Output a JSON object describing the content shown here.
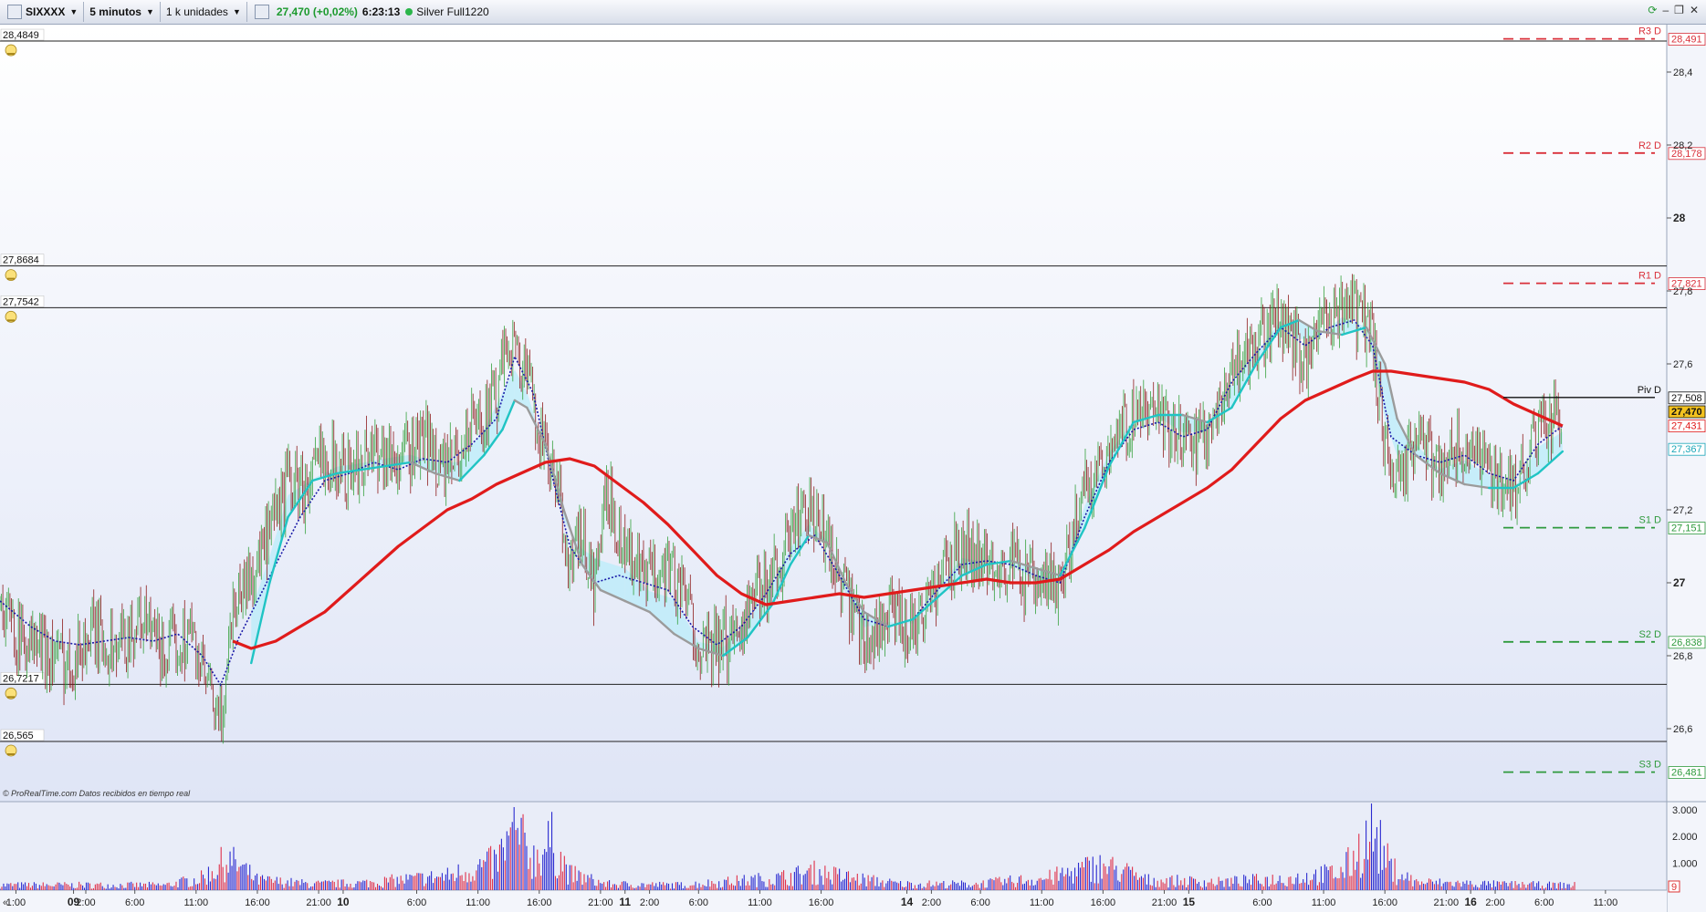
{
  "toolbar": {
    "symbol": "SIXXXX",
    "interval": "5 minutos",
    "units": "1 k unidades",
    "price": "27,470 (+0,02%)",
    "time": "6:23:13",
    "account": "Silver Full1220",
    "window_icons": [
      "refresh-icon",
      "minimize-icon",
      "restore-icon",
      "close-icon"
    ]
  },
  "copyright": "© ProRealTime.com  Datos recibidos en tiempo real",
  "colors": {
    "ma_long": "#e01b1b",
    "ma_short": "#20c4c4",
    "ma_short_falling": "#9b9b9b",
    "dotted": "#1a1aa8",
    "candles_up": "#2e9e35",
    "candles_down": "#8b1313",
    "cloud": "#b9ecfa",
    "resistance": "#d9303a",
    "support": "#2f9a3d",
    "pivot": "#111111",
    "price_tag": "#f3c21f"
  },
  "chart_data": {
    "type": "line",
    "ylim": [
      26.4,
      28.53
    ],
    "y_ticks": [
      "28,4",
      "28,2",
      "28",
      "27,8",
      "27,6",
      "27,2",
      "27",
      "26,8",
      "26,6"
    ],
    "x_ticks": [
      {
        "label": "1:00",
        "t": -2.2
      },
      {
        "label": "09",
        "t": 2.5,
        "bold": true
      },
      {
        "label": "2:00",
        "t": 3.5
      },
      {
        "label": "6:00",
        "t": 7.5
      },
      {
        "label": "11:00",
        "t": 12.5
      },
      {
        "label": "16:00",
        "t": 17.5
      },
      {
        "label": "21:00",
        "t": 22.5
      },
      {
        "label": "10",
        "t": 24.5,
        "bold": true
      },
      {
        "label": "6:00",
        "t": 30.5
      },
      {
        "label": "11:00",
        "t": 35.5
      },
      {
        "label": "16:00",
        "t": 40.5
      },
      {
        "label": "21:00",
        "t": 45.5
      },
      {
        "label": "11",
        "t": 47.5,
        "bold": true
      },
      {
        "label": "2:00",
        "t": 49.5
      },
      {
        "label": "6:00",
        "t": 53.5
      },
      {
        "label": "11:00",
        "t": 58.5
      },
      {
        "label": "16:00",
        "t": 63.5
      },
      {
        "label": "14",
        "t": 70.5,
        "bold": true
      },
      {
        "label": "2:00",
        "t": 72.5
      },
      {
        "label": "6:00",
        "t": 76.5
      },
      {
        "label": "11:00",
        "t": 81.5
      },
      {
        "label": "16:00",
        "t": 86.5
      },
      {
        "label": "21:00",
        "t": 91.5
      },
      {
        "label": "15",
        "t": 93.5,
        "bold": true
      },
      {
        "label": "6:00",
        "t": 99.5
      },
      {
        "label": "11:00",
        "t": 104.5
      },
      {
        "label": "16:00",
        "t": 109.5
      },
      {
        "label": "21:00",
        "t": 114.5
      },
      {
        "label": "16",
        "t": 116.5,
        "bold": true
      },
      {
        "label": "2:00",
        "t": 118.5
      },
      {
        "label": "6:00",
        "t": 122.5
      },
      {
        "label": "11:00",
        "t": 127.5
      }
    ],
    "x_range": [
      -3.5,
      132.5
    ],
    "price_series": [
      [
        -3.5,
        26.95
      ],
      [
        -2,
        26.85
      ],
      [
        0,
        26.82
      ],
      [
        2,
        26.78
      ],
      [
        4,
        26.86
      ],
      [
        6,
        26.82
      ],
      [
        8,
        26.9
      ],
      [
        10,
        26.8
      ],
      [
        12,
        26.87
      ],
      [
        13.5,
        26.7
      ],
      [
        14.5,
        26.6
      ],
      [
        15.5,
        26.95
      ],
      [
        17,
        27.02
      ],
      [
        18.5,
        27.12
      ],
      [
        20,
        27.28
      ],
      [
        21.5,
        27.25
      ],
      [
        23,
        27.36
      ],
      [
        25,
        27.3
      ],
      [
        27,
        27.38
      ],
      [
        29,
        27.33
      ],
      [
        31,
        27.4
      ],
      [
        33,
        27.3
      ],
      [
        35,
        27.43
      ],
      [
        37,
        27.5
      ],
      [
        38,
        27.68
      ],
      [
        39,
        27.6
      ],
      [
        40,
        27.5
      ],
      [
        41,
        27.35
      ],
      [
        42,
        27.25
      ],
      [
        43,
        27.05
      ],
      [
        44,
        27.12
      ],
      [
        45,
        26.98
      ],
      [
        46,
        27.25
      ],
      [
        47.5,
        27.1
      ],
      [
        49,
        27.0
      ],
      [
        51,
        27.06
      ],
      [
        53,
        26.9
      ],
      [
        54,
        26.8
      ],
      [
        56,
        26.85
      ],
      [
        58,
        26.95
      ],
      [
        60,
        27.05
      ],
      [
        62,
        27.2
      ],
      [
        64,
        27.12
      ],
      [
        65.5,
        26.95
      ],
      [
        67,
        26.85
      ],
      [
        69,
        26.9
      ],
      [
        71,
        26.88
      ],
      [
        73,
        27.0
      ],
      [
        75,
        27.1
      ],
      [
        77,
        27.06
      ],
      [
        79,
        27.05
      ],
      [
        81,
        26.98
      ],
      [
        83,
        27.0
      ],
      [
        85,
        27.25
      ],
      [
        87,
        27.38
      ],
      [
        89,
        27.45
      ],
      [
        91,
        27.45
      ],
      [
        93,
        27.38
      ],
      [
        95,
        27.4
      ],
      [
        97,
        27.58
      ],
      [
        99,
        27.65
      ],
      [
        101,
        27.73
      ],
      [
        103,
        27.6
      ],
      [
        105,
        27.72
      ],
      [
        106.5,
        27.78
      ],
      [
        107.5,
        27.72
      ],
      [
        108.5,
        27.68
      ],
      [
        109.5,
        27.35
      ],
      [
        110.5,
        27.28
      ],
      [
        112,
        27.4
      ],
      [
        114,
        27.32
      ],
      [
        116,
        27.38
      ],
      [
        118,
        27.32
      ],
      [
        120,
        27.25
      ],
      [
        122,
        27.42
      ],
      [
        124,
        27.45
      ]
    ],
    "ma_short_series": [
      [
        17,
        26.78
      ],
      [
        18.5,
        27.0
      ],
      [
        20,
        27.18
      ],
      [
        22,
        27.28
      ],
      [
        24,
        27.3
      ],
      [
        26,
        27.31
      ],
      [
        28,
        27.32
      ],
      [
        30,
        27.33
      ],
      [
        32,
        27.3
      ],
      [
        34,
        27.28
      ],
      [
        36,
        27.35
      ],
      [
        37.5,
        27.42
      ],
      [
        38.5,
        27.5
      ],
      [
        39.5,
        27.48
      ],
      [
        41,
        27.38
      ],
      [
        42.5,
        27.2
      ],
      [
        44,
        27.05
      ],
      [
        45.5,
        26.98
      ],
      [
        47.5,
        26.95
      ],
      [
        49.5,
        26.92
      ],
      [
        51.5,
        26.86
      ],
      [
        53.5,
        26.82
      ],
      [
        55.5,
        26.8
      ],
      [
        57.5,
        26.85
      ],
      [
        59.5,
        26.94
      ],
      [
        61,
        27.05
      ],
      [
        62.5,
        27.13
      ],
      [
        64,
        27.11
      ],
      [
        65.5,
        27.0
      ],
      [
        67,
        26.92
      ],
      [
        69,
        26.88
      ],
      [
        71,
        26.9
      ],
      [
        73,
        26.96
      ],
      [
        75,
        27.02
      ],
      [
        77,
        27.05
      ],
      [
        79,
        27.06
      ],
      [
        81,
        27.04
      ],
      [
        83,
        27.02
      ],
      [
        85,
        27.15
      ],
      [
        87,
        27.32
      ],
      [
        89,
        27.44
      ],
      [
        91,
        27.46
      ],
      [
        93,
        27.46
      ],
      [
        95,
        27.44
      ],
      [
        97,
        27.48
      ],
      [
        99,
        27.6
      ],
      [
        101,
        27.7
      ],
      [
        102.5,
        27.72
      ],
      [
        104,
        27.69
      ],
      [
        106,
        27.68
      ],
      [
        108,
        27.7
      ],
      [
        109.5,
        27.6
      ],
      [
        110.5,
        27.45
      ],
      [
        112,
        27.35
      ],
      [
        114,
        27.3
      ],
      [
        116,
        27.27
      ],
      [
        118,
        27.26
      ],
      [
        120,
        27.26
      ],
      [
        122,
        27.3
      ],
      [
        124,
        27.36
      ]
    ],
    "ma_long_series": [
      [
        15.5,
        26.84
      ],
      [
        17,
        26.82
      ],
      [
        19,
        26.84
      ],
      [
        21,
        26.88
      ],
      [
        23,
        26.92
      ],
      [
        25,
        26.98
      ],
      [
        27,
        27.04
      ],
      [
        29,
        27.1
      ],
      [
        31,
        27.15
      ],
      [
        33,
        27.2
      ],
      [
        35,
        27.23
      ],
      [
        37,
        27.27
      ],
      [
        39,
        27.3
      ],
      [
        41,
        27.33
      ],
      [
        43,
        27.34
      ],
      [
        45,
        27.32
      ],
      [
        47,
        27.27
      ],
      [
        49,
        27.22
      ],
      [
        51,
        27.16
      ],
      [
        53,
        27.09
      ],
      [
        55,
        27.02
      ],
      [
        57,
        26.97
      ],
      [
        59,
        26.94
      ],
      [
        61,
        26.95
      ],
      [
        63,
        26.96
      ],
      [
        65,
        26.97
      ],
      [
        67,
        26.96
      ],
      [
        69,
        26.97
      ],
      [
        71,
        26.98
      ],
      [
        73,
        26.99
      ],
      [
        75,
        27.0
      ],
      [
        77,
        27.01
      ],
      [
        79,
        27.0
      ],
      [
        81,
        27.0
      ],
      [
        83,
        27.01
      ],
      [
        85,
        27.05
      ],
      [
        87,
        27.09
      ],
      [
        89,
        27.14
      ],
      [
        91,
        27.18
      ],
      [
        93,
        27.22
      ],
      [
        95,
        27.26
      ],
      [
        97,
        27.31
      ],
      [
        99,
        27.38
      ],
      [
        101,
        27.45
      ],
      [
        103,
        27.5
      ],
      [
        105,
        27.53
      ],
      [
        107,
        27.56
      ],
      [
        108.5,
        27.58
      ],
      [
        110,
        27.58
      ],
      [
        112,
        27.57
      ],
      [
        114,
        27.56
      ],
      [
        116,
        27.55
      ],
      [
        118,
        27.53
      ],
      [
        120,
        27.49
      ],
      [
        122,
        27.46
      ],
      [
        124,
        27.43
      ]
    ],
    "dotted_series": [
      [
        -3.5,
        26.95
      ],
      [
        -1,
        26.88
      ],
      [
        1,
        26.84
      ],
      [
        3,
        26.83
      ],
      [
        5,
        26.84
      ],
      [
        7,
        26.85
      ],
      [
        9,
        26.84
      ],
      [
        11,
        26.86
      ],
      [
        13,
        26.8
      ],
      [
        14.5,
        26.72
      ],
      [
        16,
        26.85
      ],
      [
        17.5,
        26.95
      ],
      [
        19,
        27.05
      ],
      [
        21,
        27.18
      ],
      [
        23,
        27.28
      ],
      [
        25,
        27.3
      ],
      [
        27,
        27.33
      ],
      [
        29,
        27.31
      ],
      [
        31,
        27.34
      ],
      [
        33,
        27.33
      ],
      [
        35,
        27.38
      ],
      [
        37,
        27.45
      ],
      [
        38.5,
        27.62
      ],
      [
        40,
        27.52
      ],
      [
        41.5,
        27.3
      ],
      [
        43,
        27.1
      ],
      [
        45,
        27.0
      ],
      [
        47,
        27.02
      ],
      [
        49,
        27.0
      ],
      [
        51,
        26.98
      ],
      [
        53,
        26.88
      ],
      [
        55,
        26.83
      ],
      [
        57,
        26.88
      ],
      [
        59,
        26.97
      ],
      [
        61,
        27.08
      ],
      [
        63,
        27.13
      ],
      [
        65,
        27.02
      ],
      [
        67,
        26.9
      ],
      [
        69,
        26.88
      ],
      [
        71,
        26.9
      ],
      [
        73,
        26.98
      ],
      [
        75,
        27.05
      ],
      [
        77,
        27.06
      ],
      [
        79,
        27.05
      ],
      [
        81,
        27.02
      ],
      [
        83,
        27.0
      ],
      [
        85,
        27.18
      ],
      [
        87,
        27.33
      ],
      [
        89,
        27.42
      ],
      [
        91,
        27.44
      ],
      [
        93,
        27.4
      ],
      [
        95,
        27.42
      ],
      [
        97,
        27.55
      ],
      [
        99,
        27.63
      ],
      [
        101,
        27.7
      ],
      [
        103,
        27.65
      ],
      [
        105,
        27.7
      ],
      [
        107,
        27.72
      ],
      [
        108.5,
        27.65
      ],
      [
        110,
        27.4
      ],
      [
        112,
        27.35
      ],
      [
        114,
        27.33
      ],
      [
        116,
        27.35
      ],
      [
        118,
        27.3
      ],
      [
        120,
        27.28
      ],
      [
        122,
        27.38
      ],
      [
        124,
        27.43
      ]
    ],
    "horizontal_lines": [
      {
        "label": "28,4849",
        "value": 28.4849
      },
      {
        "label": "27,8684",
        "value": 27.8684
      },
      {
        "label": "27,7542",
        "value": 27.7542
      },
      {
        "label": "26,7217",
        "value": 26.7217
      },
      {
        "label": "26,565",
        "value": 26.565
      }
    ],
    "pivot_levels": [
      {
        "name": "R3 D",
        "label": "28,491",
        "value": 28.491,
        "kind": "resistance"
      },
      {
        "name": "R2 D",
        "label": "28,178",
        "value": 28.178,
        "kind": "resistance"
      },
      {
        "name": "R1 D",
        "label": "27,821",
        "value": 27.821,
        "kind": "resistance"
      },
      {
        "name": "Piv D",
        "label": "27,508",
        "value": 27.508,
        "kind": "pivot"
      },
      {
        "name": "S1 D",
        "label": "27,151",
        "value": 27.151,
        "kind": "support"
      },
      {
        "name": "S2 D",
        "label": "26,838",
        "value": 26.838,
        "kind": "support"
      },
      {
        "name": "S3 D",
        "label": "26,481",
        "value": 26.481,
        "kind": "support"
      }
    ],
    "value_tags": [
      {
        "label": "27,470",
        "value": 27.47,
        "kind": "price"
      },
      {
        "label": "27,431",
        "value": 27.431,
        "kind": "ma_long"
      },
      {
        "label": "27,367",
        "value": 27.367,
        "kind": "ma_short"
      }
    ],
    "volume": {
      "ylim": [
        0,
        3.3
      ],
      "y_ticks": [
        "3.000",
        "2.000",
        "1.000"
      ],
      "last_label": "9",
      "profile": [
        [
          -3.5,
          0.25
        ],
        [
          10,
          0.25
        ],
        [
          13,
          0.6
        ],
        [
          15,
          1.5
        ],
        [
          16,
          1.2
        ],
        [
          17.5,
          0.5
        ],
        [
          22,
          0.3
        ],
        [
          26,
          0.35
        ],
        [
          33,
          0.7
        ],
        [
          37,
          1.4
        ],
        [
          38.5,
          2.9
        ],
        [
          40,
          1.6
        ],
        [
          41.5,
          2.4
        ],
        [
          43,
          0.8
        ],
        [
          46,
          0.3
        ],
        [
          52,
          0.25
        ],
        [
          60,
          0.6
        ],
        [
          63,
          0.9
        ],
        [
          66,
          0.6
        ],
        [
          70,
          0.3
        ],
        [
          76,
          0.3
        ],
        [
          82,
          0.6
        ],
        [
          86,
          1.2
        ],
        [
          88,
          1.0
        ],
        [
          90,
          0.5
        ],
        [
          96,
          0.4
        ],
        [
          102,
          0.6
        ],
        [
          106,
          0.9
        ],
        [
          108.5,
          2.9
        ],
        [
          110,
          1.1
        ],
        [
          112,
          0.4
        ],
        [
          118,
          0.3
        ],
        [
          124,
          0.25
        ]
      ]
    }
  }
}
